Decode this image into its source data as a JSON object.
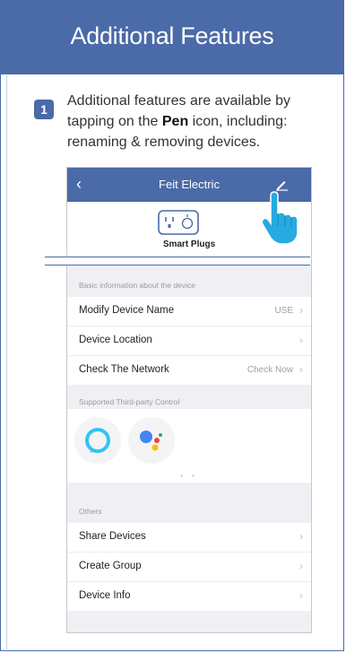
{
  "header": {
    "title": "Additional Features"
  },
  "step": {
    "number": "1",
    "text_before": "Additional features are available by tapping on the ",
    "text_bold": "Pen",
    "text_after": " icon, including: renaming & removing devices."
  },
  "phone": {
    "app_bar": {
      "title": "Feit Electric",
      "back_icon": "chevron-left-icon",
      "edit_icon": "pen-icon"
    },
    "device": {
      "name": "Smart Plugs",
      "icon": "smart-plug-icon"
    },
    "basic_section": {
      "label": "Basic information about the device",
      "rows": [
        {
          "label": "Modify Device Name",
          "value": "USE"
        },
        {
          "label": "Device Location",
          "value": ""
        },
        {
          "label": "Check The Network",
          "value": "Check Now"
        }
      ]
    },
    "third_party_section": {
      "label": "Supported Third-party Control",
      "items": [
        {
          "name": "alexa-icon"
        },
        {
          "name": "google-assistant-icon"
        }
      ],
      "page_indicator": "• •"
    },
    "others_section": {
      "label": "Others",
      "rows": [
        {
          "label": "Share Devices"
        },
        {
          "label": "Create Group"
        },
        {
          "label": "Device Info"
        }
      ]
    }
  },
  "colors": {
    "accent": "#4a6aa8",
    "alexa": "#31c4f3"
  }
}
